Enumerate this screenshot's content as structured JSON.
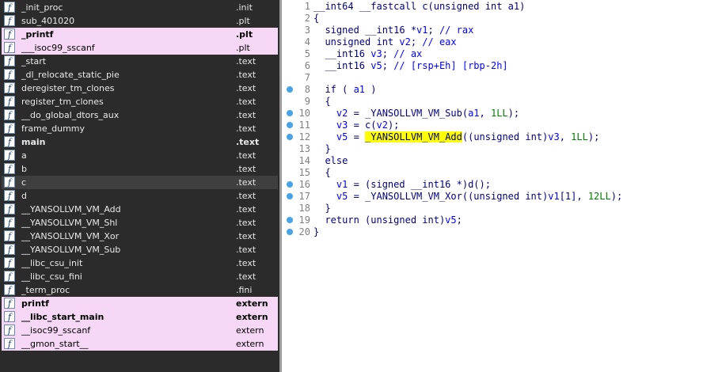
{
  "functions": [
    {
      "name": "_init_proc",
      "segment": ".init",
      "bold": false,
      "extern": false
    },
    {
      "name": "sub_401020",
      "segment": ".plt",
      "bold": false,
      "extern": false
    },
    {
      "name": "_printf",
      "segment": ".plt",
      "bold": true,
      "extern": true
    },
    {
      "name": "___isoc99_sscanf",
      "segment": ".plt",
      "bold": false,
      "extern": true
    },
    {
      "name": "_start",
      "segment": ".text",
      "bold": false,
      "extern": false
    },
    {
      "name": "_dl_relocate_static_pie",
      "segment": ".text",
      "bold": false,
      "extern": false
    },
    {
      "name": "deregister_tm_clones",
      "segment": ".text",
      "bold": false,
      "extern": false
    },
    {
      "name": "register_tm_clones",
      "segment": ".text",
      "bold": false,
      "extern": false
    },
    {
      "name": "__do_global_dtors_aux",
      "segment": ".text",
      "bold": false,
      "extern": false
    },
    {
      "name": "frame_dummy",
      "segment": ".text",
      "bold": false,
      "extern": false
    },
    {
      "name": "main",
      "segment": ".text",
      "bold": true,
      "extern": false
    },
    {
      "name": "a",
      "segment": ".text",
      "bold": false,
      "extern": false
    },
    {
      "name": "b",
      "segment": ".text",
      "bold": false,
      "extern": false
    },
    {
      "name": "c",
      "segment": ".text",
      "bold": false,
      "extern": false,
      "selected": true
    },
    {
      "name": "d",
      "segment": ".text",
      "bold": false,
      "extern": false
    },
    {
      "name": "__YANSOLLVM_VM_Add",
      "segment": ".text",
      "bold": false,
      "extern": false
    },
    {
      "name": "__YANSOLLVM_VM_Shl",
      "segment": ".text",
      "bold": false,
      "extern": false
    },
    {
      "name": "__YANSOLLVM_VM_Xor",
      "segment": ".text",
      "bold": false,
      "extern": false
    },
    {
      "name": "__YANSOLLVM_VM_Sub",
      "segment": ".text",
      "bold": false,
      "extern": false
    },
    {
      "name": "__libc_csu_init",
      "segment": ".text",
      "bold": false,
      "extern": false
    },
    {
      "name": "__libc_csu_fini",
      "segment": ".text",
      "bold": false,
      "extern": false
    },
    {
      "name": "_term_proc",
      "segment": ".fini",
      "bold": false,
      "extern": false
    },
    {
      "name": "printf",
      "segment": "extern",
      "bold": true,
      "extern": true
    },
    {
      "name": "__libc_start_main",
      "segment": "extern",
      "bold": true,
      "extern": true
    },
    {
      "name": "__isoc99_sscanf",
      "segment": "extern",
      "bold": false,
      "extern": true
    },
    {
      "name": "__gmon_start__",
      "segment": "extern",
      "bold": false,
      "extern": true
    }
  ],
  "function_icon_glyph": "f",
  "code_lines": [
    {
      "n": "1",
      "dot": false,
      "parts": [
        [
          "",
          "__int64 __fastcall c(unsigned int a1)"
        ]
      ]
    },
    {
      "n": "2",
      "dot": false,
      "parts": [
        [
          "",
          "{"
        ]
      ]
    },
    {
      "n": "3",
      "dot": false,
      "parts": [
        [
          "",
          "  signed __int16 *"
        ],
        [
          "vr",
          "v1"
        ],
        [
          "",
          ";"
        ],
        [
          "cm",
          " // rax"
        ]
      ]
    },
    {
      "n": "4",
      "dot": false,
      "parts": [
        [
          "",
          "  unsigned int "
        ],
        [
          "vr",
          "v2"
        ],
        [
          "",
          ";"
        ],
        [
          "cm",
          " // eax"
        ]
      ]
    },
    {
      "n": "5",
      "dot": false,
      "parts": [
        [
          "",
          "  __int16 "
        ],
        [
          "vr",
          "v3"
        ],
        [
          "",
          ";"
        ],
        [
          "cm",
          " // ax"
        ]
      ]
    },
    {
      "n": "6",
      "dot": false,
      "parts": [
        [
          "",
          "  __int16 "
        ],
        [
          "vr",
          "v5"
        ],
        [
          "",
          ";"
        ],
        [
          "cm",
          " // [rsp+Eh] [rbp-2h]"
        ]
      ]
    },
    {
      "n": "7",
      "dot": false,
      "parts": [
        [
          "",
          ""
        ]
      ]
    },
    {
      "n": "8",
      "dot": true,
      "parts": [
        [
          "",
          "  if ( "
        ],
        [
          "vr",
          "a1"
        ],
        [
          "",
          " )"
        ]
      ]
    },
    {
      "n": "9",
      "dot": false,
      "parts": [
        [
          "",
          "  {"
        ]
      ]
    },
    {
      "n": "10",
      "dot": true,
      "parts": [
        [
          "",
          "    "
        ],
        [
          "vr",
          "v2"
        ],
        [
          "",
          " = _YANSOLLVM_VM_Sub("
        ],
        [
          "vr",
          "a1"
        ],
        [
          "",
          ", "
        ],
        [
          "nm",
          "1LL"
        ],
        [
          "",
          ");"
        ]
      ]
    },
    {
      "n": "11",
      "dot": true,
      "parts": [
        [
          "",
          "    "
        ],
        [
          "vr",
          "v3"
        ],
        [
          "",
          " = c("
        ],
        [
          "vr",
          "v2"
        ],
        [
          "",
          ");"
        ]
      ]
    },
    {
      "n": "12",
      "dot": true,
      "parts": [
        [
          "",
          "    "
        ],
        [
          "vr",
          "v5"
        ],
        [
          "",
          " = "
        ],
        [
          "hl",
          "_YANSOLLVM_VM_Add"
        ],
        [
          "",
          "((unsigned int)"
        ],
        [
          "vr",
          "v3"
        ],
        [
          "",
          ", "
        ],
        [
          "nm",
          "1LL"
        ],
        [
          "",
          ");"
        ]
      ]
    },
    {
      "n": "13",
      "dot": false,
      "parts": [
        [
          "",
          "  }"
        ]
      ]
    },
    {
      "n": "14",
      "dot": false,
      "parts": [
        [
          "",
          "  else"
        ]
      ]
    },
    {
      "n": "15",
      "dot": false,
      "parts": [
        [
          "",
          "  {"
        ]
      ]
    },
    {
      "n": "16",
      "dot": true,
      "parts": [
        [
          "",
          "    "
        ],
        [
          "vr",
          "v1"
        ],
        [
          "",
          " = (signed __int16 *)d();"
        ]
      ]
    },
    {
      "n": "17",
      "dot": true,
      "parts": [
        [
          "",
          "    "
        ],
        [
          "vr",
          "v5"
        ],
        [
          "",
          " = _YANSOLLVM_VM_Xor((unsigned int)"
        ],
        [
          "vr",
          "v1"
        ],
        [
          "",
          "[1], "
        ],
        [
          "nm",
          "12LL"
        ],
        [
          "",
          ");"
        ]
      ]
    },
    {
      "n": "18",
      "dot": false,
      "parts": [
        [
          "",
          "  }"
        ]
      ]
    },
    {
      "n": "19",
      "dot": true,
      "parts": [
        [
          "",
          "  return (unsigned int)"
        ],
        [
          "vr",
          "v5"
        ],
        [
          "",
          ";"
        ]
      ]
    },
    {
      "n": "20",
      "dot": true,
      "parts": [
        [
          "",
          "}"
        ]
      ]
    }
  ],
  "colors": {
    "function_pane_bg": "#2b2b2b",
    "extern_row_bg": "#f6d8f6",
    "code_text": "#000080",
    "comment": "#0000ff",
    "number": "#008000",
    "highlight": "#ffff00",
    "breakpoint_dot": "#46a3e8"
  }
}
